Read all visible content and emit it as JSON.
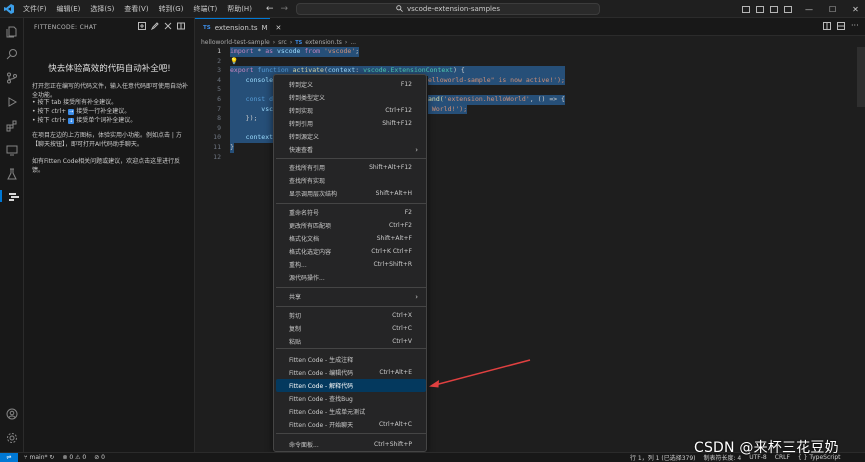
{
  "titlebar": {
    "menu": [
      "文件(F)",
      "编辑(E)",
      "选择(S)",
      "查看(V)",
      "转到(G)",
      "终端(T)",
      "帮助(H)"
    ],
    "search_text": "vscode-extension-samples",
    "win_minimize": "—",
    "win_maximize": "☐",
    "win_close": "✕"
  },
  "sidebar": {
    "header": "FITTENCODE: CHAT",
    "welcome_title": "快去体验高效的代码自动补全吧!",
    "intro": "打开您正在编写的代码文件，输入任意代码即可使用自动补全功能。",
    "tips": [
      "• 按下 tab 接受所有补全建议。",
      "• 按下 ctrl+ ",
      " 接受一行补全建议。",
      "• 按下 ctrl+ ",
      " 接受单个词补全建议。"
    ],
    "kbd_right": "→",
    "kbd_down": "↓",
    "chat_hint": "在项目左边的上方图标，体验实用小功能。例如点击 | 方【聊天按钮】，即可打开AI代码助手聊天。",
    "feedback": "如有Fitten Code相关问题或建议，欢迎点击这里进行反馈。"
  },
  "editor": {
    "tab_lang": "TS",
    "tab_name": "extension.ts",
    "tab_status": "M",
    "breadcrumb": [
      "helloworld-test-sample",
      "src",
      "TS",
      "extension.ts",
      "..."
    ],
    "line_numbers": [
      "1",
      "2",
      "3",
      "4",
      "5",
      "6",
      "7",
      "8",
      "9",
      "10",
      "11",
      "12"
    ],
    "code": {
      "l1_import": "import",
      "l1_star": " * ",
      "l1_as": "as",
      "l1_vscode": " vscode ",
      "l1_from": "from",
      "l1_str": " 'vscode'",
      "l1_end": ";",
      "l4_export": "export",
      "l4_function": " function ",
      "l4_name": "activate",
      "l4_paren": "(",
      "l4_param": "context",
      "l4_colon": ": ",
      "l4_type": "vscode.ExtensionContext",
      "l4_end": ") {",
      "l5_console": "    console",
      "l5_str": "elloworld-sample\" is now active!');",
      "l7_const": "    const d",
      "l7_cmd_prefix": "and(",
      "l7_cmd_str": "'extension.helloWorld'",
      "l7_cmd_end": ", () => {",
      "l8_vsc": "        vsc",
      "l8_str": " World!');",
      "l9_close": "    });",
      "l11_context": "    context",
      "l12_brace": "}"
    }
  },
  "context_menu": {
    "items": [
      {
        "label": "转到定义",
        "key": "F12"
      },
      {
        "label": "转到类型定义",
        "key": ""
      },
      {
        "label": "转到实现",
        "key": "Ctrl+F12"
      },
      {
        "label": "转到引用",
        "key": "Shift+F12"
      },
      {
        "label": "转到源定义",
        "key": ""
      },
      {
        "label": "快速查看",
        "key": "",
        "submenu": true
      },
      {
        "label": "查找所有引用",
        "key": "Shift+Alt+F12"
      },
      {
        "label": "查找所有实现",
        "key": ""
      },
      {
        "label": "显示调用层次结构",
        "key": "Shift+Alt+H"
      },
      {
        "label": "重命名符号",
        "key": "F2"
      },
      {
        "label": "更改所有匹配项",
        "key": "Ctrl+F2"
      },
      {
        "label": "格式化文档",
        "key": "Shift+Alt+F"
      },
      {
        "label": "格式化选定内容",
        "key": "Ctrl+K Ctrl+F"
      },
      {
        "label": "重构...",
        "key": "Ctrl+Shift+R"
      },
      {
        "label": "源代码操作...",
        "key": ""
      },
      {
        "label": "共享",
        "key": "",
        "submenu": true
      },
      {
        "label": "剪切",
        "key": "Ctrl+X"
      },
      {
        "label": "复制",
        "key": "Ctrl+C"
      },
      {
        "label": "粘贴",
        "key": "Ctrl+V"
      },
      {
        "label": "Fitten Code - 生成注释",
        "key": ""
      },
      {
        "label": "Fitten Code - 编辑代码",
        "key": "Ctrl+Alt+E"
      },
      {
        "label": "Fitten Code - 解释代码",
        "key": "",
        "selected": true
      },
      {
        "label": "Fitten Code - 查找Bug",
        "key": ""
      },
      {
        "label": "Fitten Code - 生成单元测试",
        "key": ""
      },
      {
        "label": "Fitten Code - 开始聊天",
        "key": "Ctrl+Alt+C"
      },
      {
        "label": "命令面板...",
        "key": "Ctrl+Shift+P"
      }
    ],
    "submenu_arrow": "›"
  },
  "statusbar": {
    "branch": "main*",
    "errors": "⊗ 0 ⚠ 0",
    "ports": "⊘ 0",
    "position": "行 1，列 1 (已选择379)",
    "spaces": "制表符长度: 4",
    "encoding": "UTF-8",
    "eol": "CRLF",
    "language": "{ } TypeScript"
  },
  "watermark": "CSDN @来杯三花豆奶",
  "colors": {
    "accent": "#0078d4",
    "selected_item": "#04395e",
    "annotation_arrow": "#e04040"
  }
}
